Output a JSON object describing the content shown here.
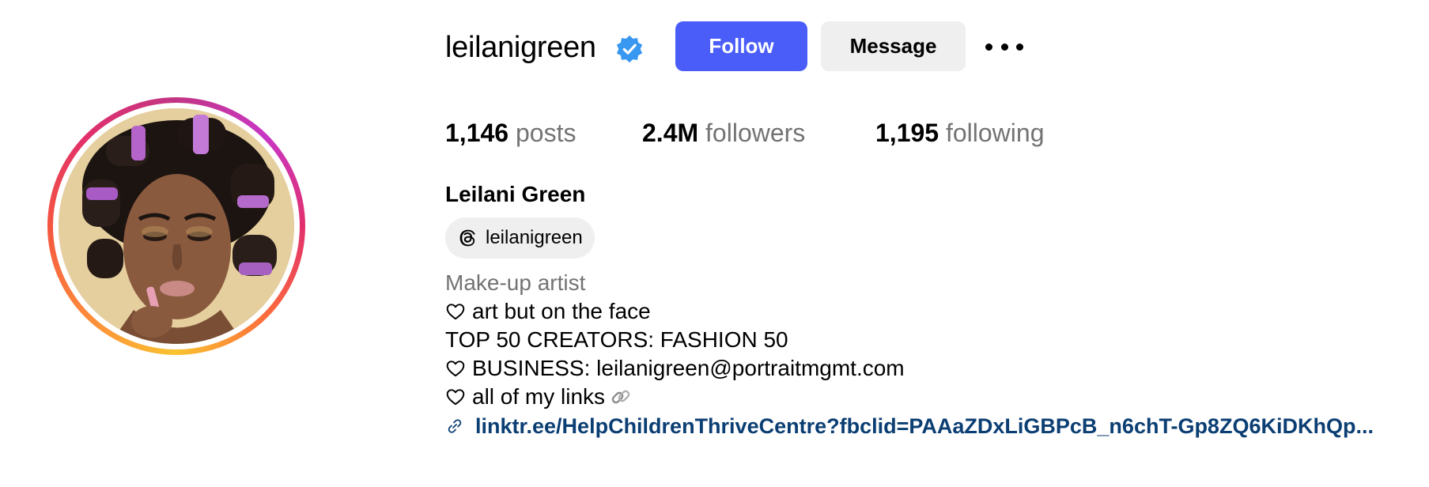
{
  "profile": {
    "username": "leilanigreen",
    "verified_icon": "verified-badge-icon",
    "follow_label": "Follow",
    "message_label": "Message",
    "more_icon": "more-options-icon"
  },
  "stats": {
    "posts_count": "1,146",
    "posts_label": "posts",
    "followers_count": "2.4M",
    "followers_label": "followers",
    "following_count": "1,195",
    "following_label": "following"
  },
  "bio": {
    "full_name": "Leilani Green",
    "threads_handle": "leilanigreen",
    "category": "Make-up artist",
    "line1": "art but on the face",
    "line2": "TOP 50 CREATORS: FASHION 50",
    "line3": "BUSINESS: leilanigreen@portraitmgmt.com",
    "line4": "all of my links",
    "link_text": "linktr.ee/HelpChildrenThriveCentre?fbclid=PAAaZDxLiGBPcB_n6chT-Gp8ZQ6KiDKhQp..."
  },
  "colors": {
    "follow_button": "#4a5df9",
    "secondary_button": "#efefef",
    "muted_text": "#737373",
    "link_text": "#0b3e73",
    "verified_badge": "#3897f0"
  }
}
